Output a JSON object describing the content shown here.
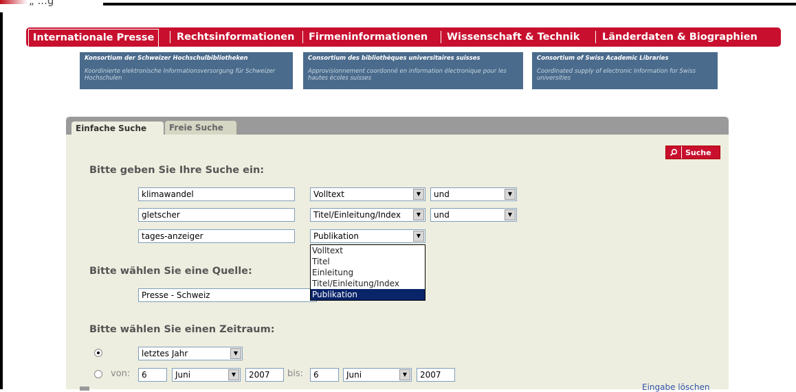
{
  "top_clip_text": "„ ...g",
  "nav": {
    "items": [
      "Internationale Presse",
      "Rechtsinformationen",
      "Firmeninformationen",
      "Wissenschaft & Technik",
      "Länderdaten & Biographien"
    ],
    "active_index": 0
  },
  "consortium": [
    {
      "title": "Konsortium der Schweizer Hochschulbibliotheken",
      "desc": "Koordinierte elektronische Informationsversorgung für Schweizer Hochschulen"
    },
    {
      "title": "Consortium des bibliothèques universitaires suisses",
      "desc": "Approvisionnement coordonné en information électronique pour les hautes écoles suisses"
    },
    {
      "title": "Consortium of Swiss Academic Libraries",
      "desc": "Coordinated supply of electronic Information for Swiss universities"
    }
  ],
  "tabs": {
    "simple": "Einfache Suche",
    "free": "Freie Suche"
  },
  "search_button": "Suche",
  "search_section_title": "Bitte geben Sie Ihre Suche ein:",
  "rows": [
    {
      "term": "klimawandel",
      "field": "Volltext",
      "operator": "und"
    },
    {
      "term": "gletscher",
      "field": "Titel/Einleitung/Index",
      "operator": "und"
    },
    {
      "term": "tages-anzeiger",
      "field": "Publikation"
    }
  ],
  "field_options": [
    "Volltext",
    "Titel",
    "Einleitung",
    "Titel/Einleitung/Index",
    "Publikation"
  ],
  "field_selected_index": 4,
  "source_section_title": "Bitte wählen Sie eine Quelle:",
  "source_value": "Presse - Schweiz",
  "period_section_title": "Bitte wählen Sie einen Zeitraum:",
  "period_preset": "letztes Jahr",
  "period_custom": {
    "from_label": "von:",
    "from_day": "6",
    "from_month": "Juni",
    "from_year": "2007",
    "to_label": "bis:",
    "to_day": "6",
    "to_month": "Juni",
    "to_year": "2007"
  },
  "bottom_link": "Eingabe löschen",
  "colors": {
    "nav_red": "#c8102e",
    "consortium_blue": "#4a6b8c",
    "panel_beige": "#eeeee0",
    "selection_blue": "#0a246a"
  }
}
